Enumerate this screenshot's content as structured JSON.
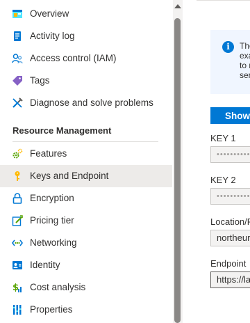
{
  "sidebar": {
    "items": [
      {
        "label": "Overview",
        "icon": "overview-icon"
      },
      {
        "label": "Activity log",
        "icon": "activity-log-icon"
      },
      {
        "label": "Access control (IAM)",
        "icon": "access-control-icon"
      },
      {
        "label": "Tags",
        "icon": "tag-icon"
      },
      {
        "label": "Diagnose and solve problems",
        "icon": "diagnose-icon"
      }
    ],
    "section_header": "Resource Management",
    "section_items": [
      {
        "label": "Features",
        "icon": "features-icon"
      },
      {
        "label": "Keys and Endpoint",
        "icon": "key-icon",
        "selected": true
      },
      {
        "label": "Encryption",
        "icon": "lock-icon"
      },
      {
        "label": "Pricing tier",
        "icon": "pricing-tier-icon"
      },
      {
        "label": "Networking",
        "icon": "networking-icon"
      },
      {
        "label": "Identity",
        "icon": "identity-icon"
      },
      {
        "label": "Cost analysis",
        "icon": "cost-analysis-icon"
      },
      {
        "label": "Properties",
        "icon": "properties-icon"
      }
    ]
  },
  "main": {
    "info": {
      "icon": "info-icon",
      "lines": [
        "The",
        "exa",
        "to r",
        "ser"
      ]
    },
    "show_button": "Show",
    "key1": {
      "label": "KEY 1",
      "value": "••••••••••"
    },
    "key2": {
      "label": "KEY 2",
      "value": "••••••••••"
    },
    "location": {
      "label": "Location/R",
      "value": "northeur"
    },
    "endpoint": {
      "label": "Endpoint",
      "value": "https://la"
    }
  },
  "colors": {
    "accent": "#0078d4",
    "selected_bg": "#edebe9",
    "info_bg": "#f0f6ff"
  }
}
